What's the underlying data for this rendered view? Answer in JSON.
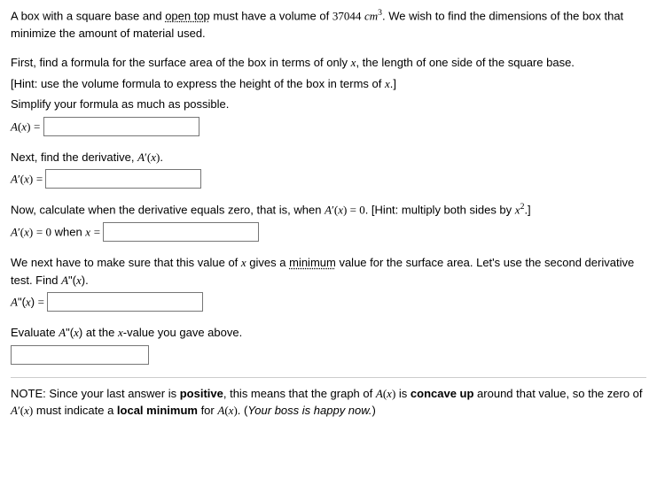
{
  "intro": {
    "p1a": "A box with a square base and ",
    "p1_underlined": "open top",
    "p1b": " must have a volume of ",
    "volume_value": "37044",
    "vol_unit_math": "cm",
    "p1c": ". We wish to find the dimensions of the box that minimize the amount of material used."
  },
  "q1": {
    "p1": "First, find a formula for the surface area of the box in terms of only ",
    "p1b": ", the length of one side of the square base.",
    "hint": "[Hint: use the volume formula to express the height of the box in terms of ",
    "hint_b": ".]",
    "simplify": "Simplify your formula as much as possible.",
    "labelA": "A",
    "labelX": "x"
  },
  "q2": {
    "text": "Next, find the derivative, ",
    "labelA": "A",
    "prime": "′",
    "labelX": "x"
  },
  "q3": {
    "p1": "Now, calculate when the derivative equals zero, that is, when ",
    "eq_rhs": " = 0",
    "hint": ". [Hint: multiply both sides by ",
    "hint_b": ".]",
    "when_text": " when "
  },
  "q4": {
    "p1": "We next have to make sure that this value of ",
    "p1b": " gives a ",
    "p1_underlined": "minimum",
    "p1c": " value for the surface area. Let's use the second derivative test. Find ",
    "labelA": "A",
    "dprime": "\"",
    "labelX": "x"
  },
  "q5": {
    "p1": "Evaluate ",
    "p1b": " at the ",
    "p1c": "-value you gave above."
  },
  "note": {
    "p1": "NOTE: Since your last answer is ",
    "b1": "positive",
    "p2": ", this means that the graph of ",
    "p3": " is ",
    "b2": "concave up",
    "p4": " around that value, so the zero of ",
    "p5": " must indicate a ",
    "b3": "local minimum",
    "p6": " for ",
    "p7": ". (",
    "i1": "Your boss is happy now.",
    "p8": ")"
  }
}
